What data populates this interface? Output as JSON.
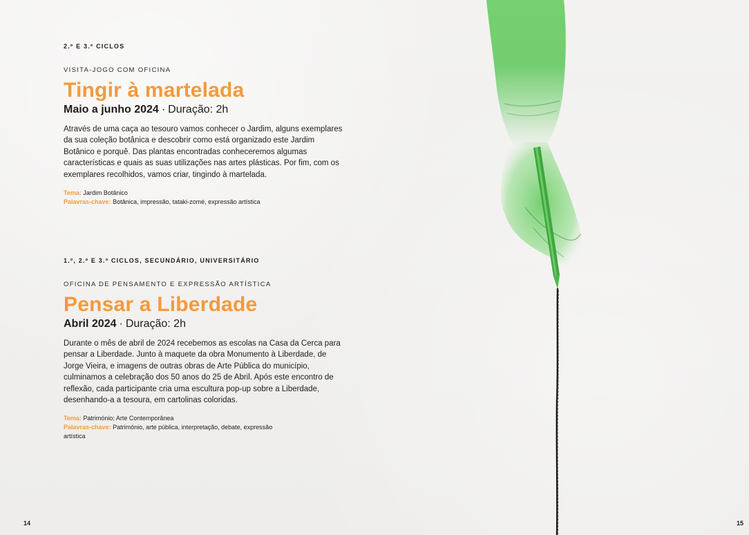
{
  "left_page": {
    "number": "14",
    "sections": [
      {
        "level": "2.º e 3.º ciclos",
        "type": "Visita-jogo com oficina",
        "title": "Tingir à martelada",
        "date": "Maio a junho 2024",
        "separator": "·",
        "duration": "Duração: 2h",
        "description": "Através de uma caça ao tesouro vamos conhecer o Jardim, alguns exemplares da sua coleção botânica e descobrir como está organizado este Jardim Botânico e porquê. Das plantas encontradas conheceremos algumas características e quais as suas utilizações nas artes plásticas. Por fim, com os exemplares recolhidos, vamos criar, tingindo à martelada.",
        "theme_label": "Tema:",
        "theme": "Jardim Botânico",
        "keywords_label": "Palavras-chave:",
        "keywords": "Botânica, impressão, tataki-zomé, expressão artística"
      },
      {
        "level": "1.º, 2.º e 3.º ciclos, secundário, universitário",
        "type": "Oficina de pensamento e expressão artística",
        "title": "Pensar a Liberdade",
        "date": "Abril 2024",
        "separator": "·",
        "duration": "Duração: 2h",
        "description": "Durante o mês de abril de 2024 recebemos as escolas na Casa da Cerca para pensar a Liberdade. Junto à maquete da obra Monumento à Liberdade, de Jorge Vieira, e imagens de outras obras de Arte Pública do município, culminamos a celebração dos 50 anos do 25 de Abril. Após este encontro de reflexão, cada participante cria uma escultura pop-up sobre a Liberdade, desenhando-a a tesoura, em cartolinas coloridas.",
        "theme_label": "Tema:",
        "theme": "Património; Arte Contemporânea",
        "keywords_label": "Palavras-chave:",
        "keywords": "Património, arte pública, interpretação, debate, expressão artística"
      }
    ]
  },
  "right_page": {
    "number": "15",
    "illustration": "green-hand-drawing-line"
  },
  "colors": {
    "accent": "#f39a3b",
    "illustration_green": "#5cc85a",
    "paper": "#f1f0ee",
    "text": "#1f1d1b"
  }
}
